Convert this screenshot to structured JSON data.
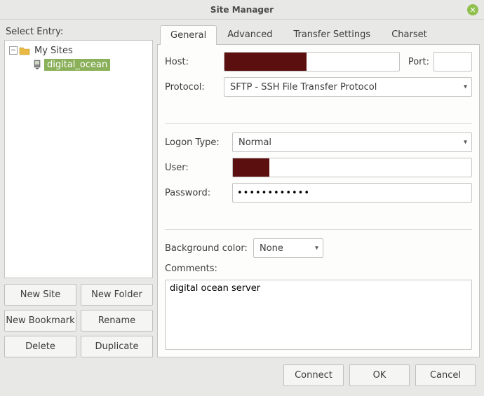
{
  "window": {
    "title": "Site Manager"
  },
  "left": {
    "select_entry_label": "Select Entry:",
    "root_label": "My Sites",
    "site_label": "digital_ocean",
    "buttons": {
      "new_site": "New Site",
      "new_folder": "New Folder",
      "new_bookmark": "New Bookmark",
      "rename": "Rename",
      "delete": "Delete",
      "duplicate": "Duplicate"
    }
  },
  "tabs": {
    "general": "General",
    "advanced": "Advanced",
    "transfer": "Transfer Settings",
    "charset": "Charset"
  },
  "form": {
    "host_label": "Host:",
    "port_label": "Port:",
    "port_value": "",
    "protocol_label": "Protocol:",
    "protocol_value": "SFTP - SSH File Transfer Protocol",
    "logon_type_label": "Logon Type:",
    "logon_type_value": "Normal",
    "user_label": "User:",
    "password_label": "Password:",
    "password_value": "••••••••••••",
    "bgcolor_label": "Background color:",
    "bgcolor_value": "None",
    "comments_label": "Comments:",
    "comments_value": "digital ocean server"
  },
  "footer": {
    "connect": "Connect",
    "ok": "OK",
    "cancel": "Cancel"
  }
}
